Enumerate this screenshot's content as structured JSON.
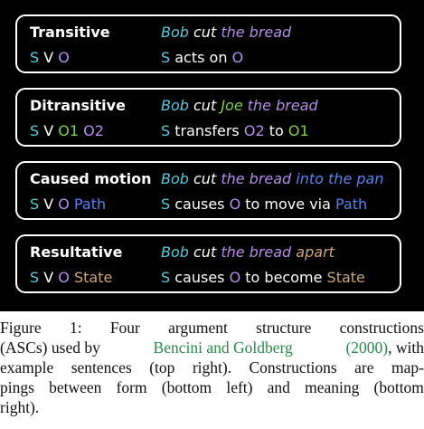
{
  "colors": {
    "subject": "#5cc9dc",
    "object": "#b58ee8",
    "o1": "#7fcf53",
    "path": "#5b82ee",
    "state": "#c9a77a",
    "white": "#ffffff",
    "citation": "#2a8a4a"
  },
  "constructions": [
    {
      "name": "Transitive",
      "example": [
        [
          "Bob",
          "subject"
        ],
        [
          " cut ",
          "white"
        ],
        [
          "the bread",
          "object"
        ]
      ],
      "form": [
        [
          "S",
          "subject"
        ],
        [
          " V ",
          "white"
        ],
        [
          "O",
          "object"
        ]
      ],
      "meaning": [
        [
          "S",
          "subject"
        ],
        [
          " acts on ",
          "white"
        ],
        [
          "O",
          "object"
        ]
      ]
    },
    {
      "name": "Ditransitive",
      "example": [
        [
          "Bob",
          "subject"
        ],
        [
          " cut ",
          "white"
        ],
        [
          "Joe",
          "o1"
        ],
        [
          " ",
          "white"
        ],
        [
          "the bread",
          "object"
        ]
      ],
      "form": [
        [
          "S",
          "subject"
        ],
        [
          " V ",
          "white"
        ],
        [
          "O1",
          "o1"
        ],
        [
          " ",
          "white"
        ],
        [
          "O2",
          "object"
        ]
      ],
      "meaning": [
        [
          "S",
          "subject"
        ],
        [
          " transfers ",
          "white"
        ],
        [
          "O2",
          "object"
        ],
        [
          " to ",
          "white"
        ],
        [
          "O1",
          "o1"
        ]
      ]
    },
    {
      "name": "Caused motion",
      "example": [
        [
          "Bob",
          "subject"
        ],
        [
          " cut ",
          "white"
        ],
        [
          "the bread",
          "object"
        ],
        [
          " ",
          "white"
        ],
        [
          "into the pan",
          "path"
        ]
      ],
      "form": [
        [
          "S",
          "subject"
        ],
        [
          " V ",
          "white"
        ],
        [
          "O",
          "object"
        ],
        [
          " ",
          "white"
        ],
        [
          "Path",
          "path"
        ]
      ],
      "meaning": [
        [
          "S",
          "subject"
        ],
        [
          " causes ",
          "white"
        ],
        [
          "O",
          "object"
        ],
        [
          " to move via ",
          "white"
        ],
        [
          "Path",
          "path"
        ]
      ]
    },
    {
      "name": "Resultative",
      "example": [
        [
          "Bob",
          "subject"
        ],
        [
          " cut ",
          "white"
        ],
        [
          "the bread",
          "object"
        ],
        [
          " ",
          "white"
        ],
        [
          "apart",
          "state"
        ]
      ],
      "form": [
        [
          "S",
          "subject"
        ],
        [
          " V ",
          "white"
        ],
        [
          "O",
          "object"
        ],
        [
          " ",
          "white"
        ],
        [
          "State",
          "state"
        ]
      ],
      "meaning": [
        [
          "S",
          "subject"
        ],
        [
          " causes ",
          "white"
        ],
        [
          "O",
          "object"
        ],
        [
          " to become ",
          "white"
        ],
        [
          "State",
          "state"
        ]
      ]
    }
  ],
  "caption": {
    "line1": [
      "Figure",
      "1:",
      "Four",
      "argument",
      "structure",
      "constructions"
    ],
    "line2_pre": "(ASCs) used by",
    "citation_text": "Bencini and Goldberg",
    "line2_year": "(2000)",
    "line2_post": ", with",
    "line3": [
      "example",
      "sentences",
      "(top",
      "right).",
      "Constructions",
      "are",
      "map-"
    ],
    "line4": [
      "pings",
      "between",
      "form",
      "(bottom",
      "left)",
      "and",
      "meaning",
      "(bottom"
    ],
    "line5": "right)."
  }
}
